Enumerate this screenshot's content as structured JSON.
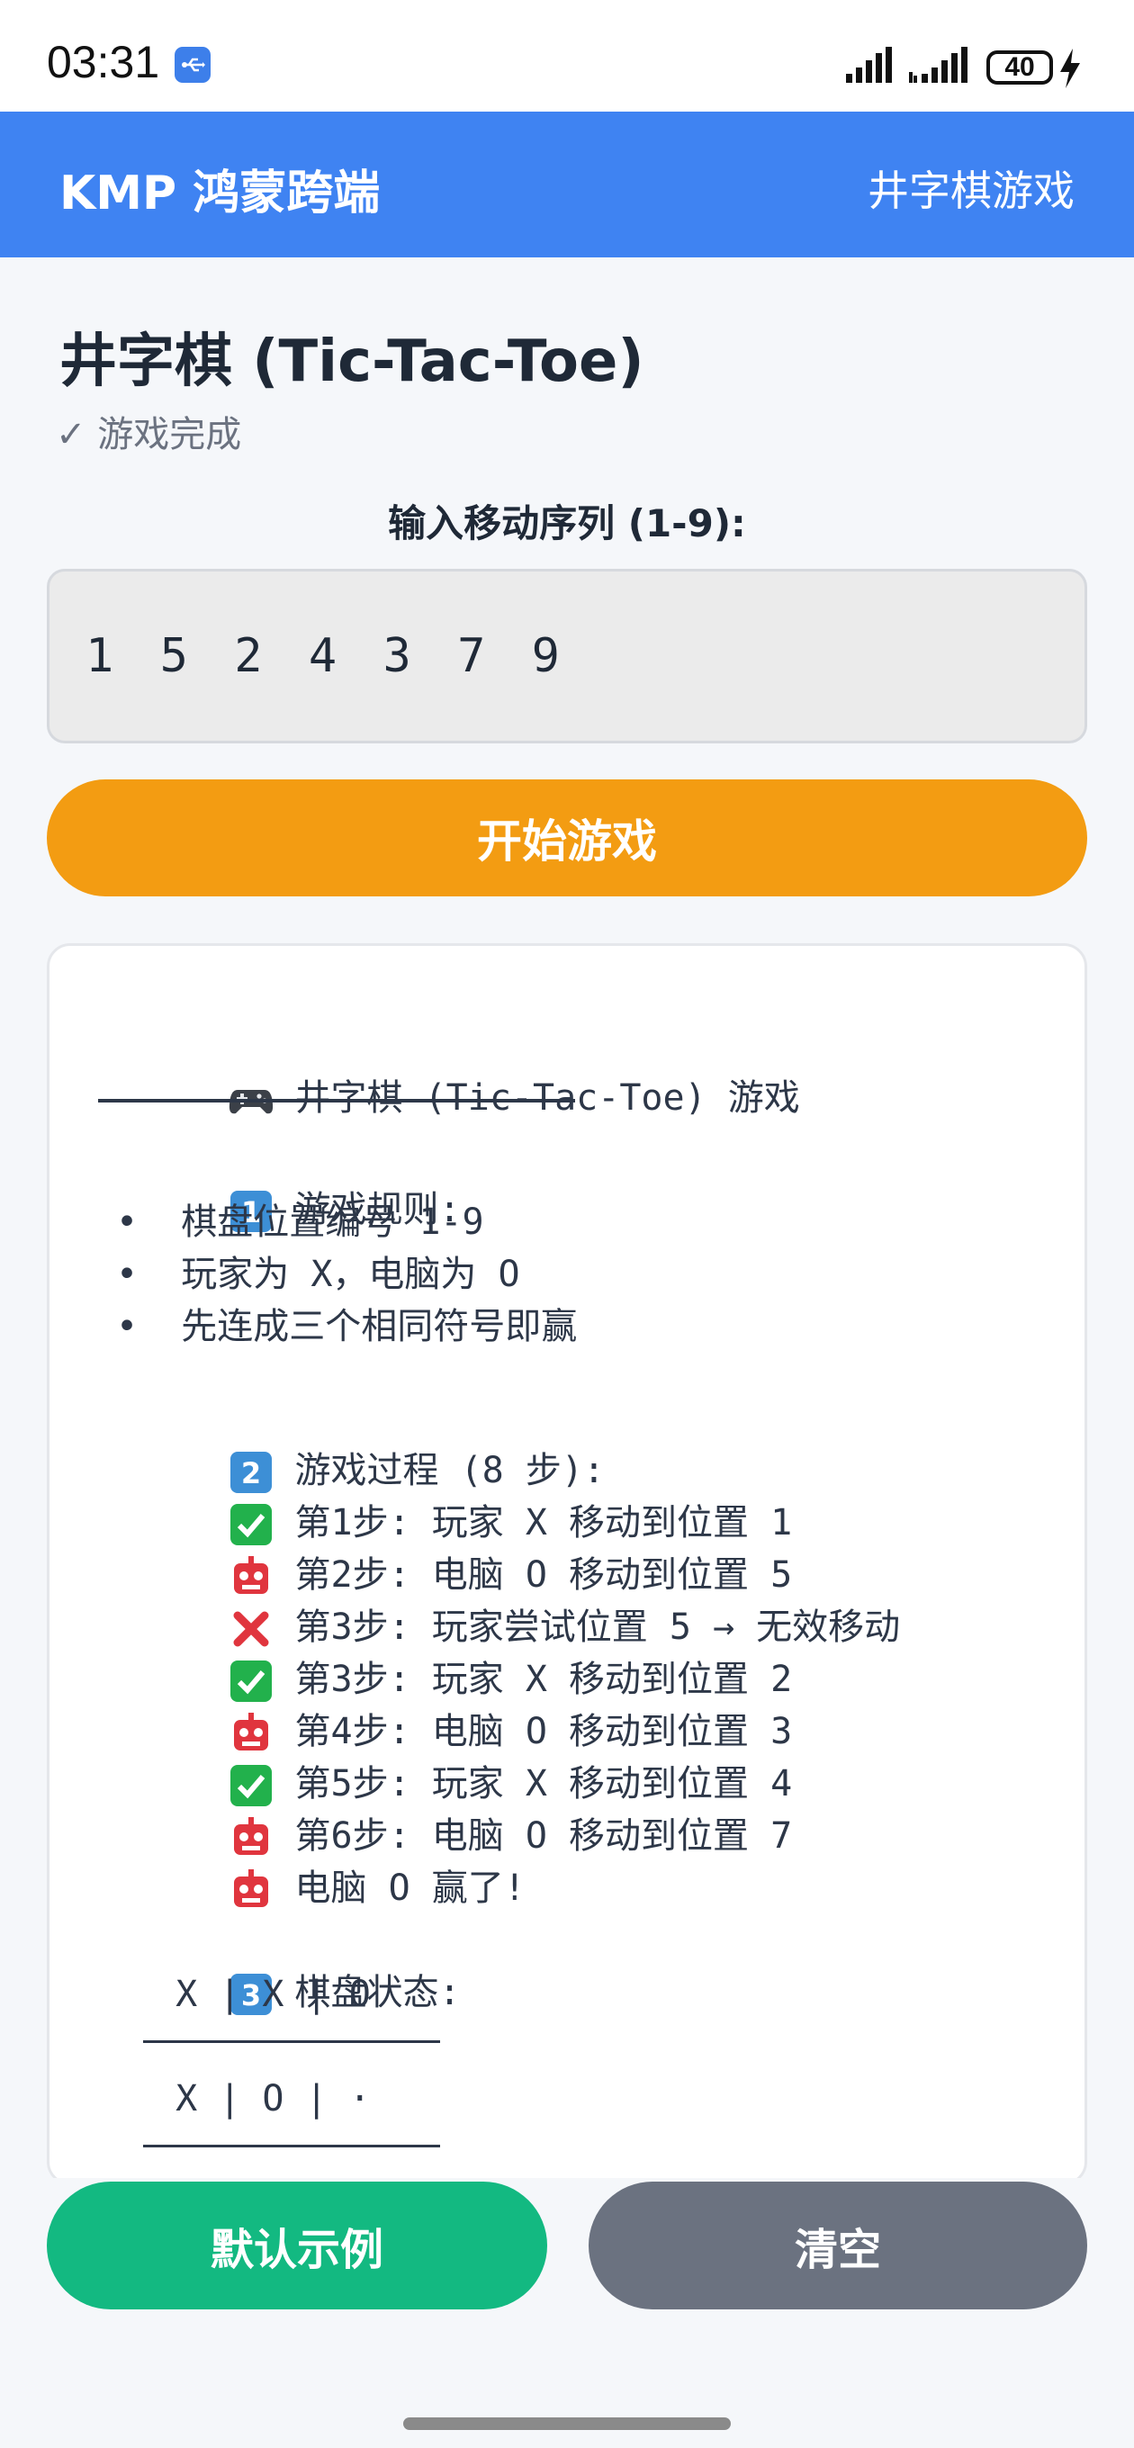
{
  "status_bar": {
    "time": "03:31",
    "battery": "40",
    "icons": [
      "usb-icon",
      "signal-icon",
      "signal-icon",
      "battery-icon",
      "charging-icon"
    ]
  },
  "app_bar": {
    "title": "KMP 鸿蒙跨端",
    "subtitle": "井字棋游戏"
  },
  "page": {
    "title": "井字棋 (Tic-Tac-Toe)",
    "status": "✓ 游戏完成",
    "input_label": "输入移动序列 (1-9):",
    "input_value": "1 5 2 4 3 7 9",
    "start_button": "开始游戏"
  },
  "output": {
    "heading": "井字棋 (Tic-Tac-Toe) 游戏",
    "rules_title": "游戏规则:",
    "rules": [
      "•  棋盘位置编号 1-9",
      "•  玩家为 X，电脑为 O",
      "•  先连成三个相同符号即赢"
    ],
    "process_title": "游戏过程 (8 步):",
    "steps": [
      {
        "icon": "check-icon",
        "text": "第1步: 玩家 X 移动到位置 1"
      },
      {
        "icon": "robot-icon",
        "text": "第2步: 电脑 O 移动到位置 5"
      },
      {
        "icon": "cross-icon",
        "text": "第3步: 玩家尝试位置 5 → 无效移动"
      },
      {
        "icon": "check-icon",
        "text": "第3步: 玩家 X 移动到位置 2"
      },
      {
        "icon": "robot-icon",
        "text": "第4步: 电脑 O 移动到位置 3"
      },
      {
        "icon": "check-icon",
        "text": "第5步: 玩家 X 移动到位置 4"
      },
      {
        "icon": "robot-icon",
        "text": "第6步: 电脑 O 移动到位置 7"
      },
      {
        "icon": "robot-icon",
        "text": "电脑 O 赢了!"
      }
    ],
    "board_title": "棋盘状态:",
    "board_rows": [
      " X | X | O",
      " X | O | ·"
    ]
  },
  "bottom": {
    "default_button": "默认示例",
    "clear_button": "清空"
  },
  "colors": {
    "app_bar": "#3f83f2",
    "start_button": "#f39c12",
    "default_button": "#13b981",
    "clear_button": "#6b7280"
  }
}
